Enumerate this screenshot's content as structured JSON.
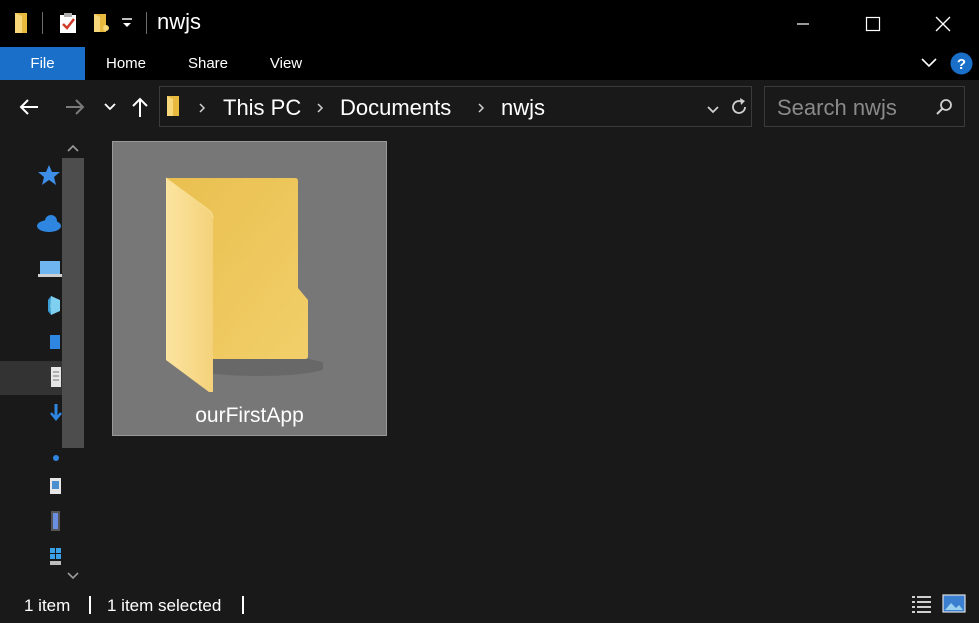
{
  "window": {
    "title": "nwjs"
  },
  "quick_access": {
    "icons": [
      "folder-icon",
      "properties-icon",
      "new-folder-icon",
      "customize-dropdown-icon"
    ]
  },
  "window_controls": {
    "icons": [
      "minimize-icon",
      "maximize-icon",
      "close-icon"
    ]
  },
  "ribbon": {
    "tabs": [
      {
        "label": "File",
        "active": true
      },
      {
        "label": "Home"
      },
      {
        "label": "Share"
      },
      {
        "label": "View"
      }
    ],
    "accent": "#1a6fc9"
  },
  "address": {
    "crumbs": [
      "This PC",
      "Documents",
      "nwjs"
    ]
  },
  "search": {
    "placeholder": "Search nwjs"
  },
  "navigation_pane": {
    "icons": [
      "quick-access-star-icon",
      "onedrive-icon",
      "this-pc-icon",
      "3d-objects-icon",
      "desktop-icon",
      "documents-icon",
      "downloads-icon",
      "music-icon",
      "pictures-icon",
      "videos-icon",
      "windows-drive-icon"
    ]
  },
  "content": {
    "items": [
      {
        "name": "ourFirstApp",
        "type": "folder",
        "selected": true
      }
    ]
  },
  "status": {
    "count": "1 item",
    "selection": "1 item selected"
  },
  "colors": {
    "background": "#191919",
    "titlebar": "#000000",
    "selection": "#777777",
    "folder": "#f0c962"
  }
}
